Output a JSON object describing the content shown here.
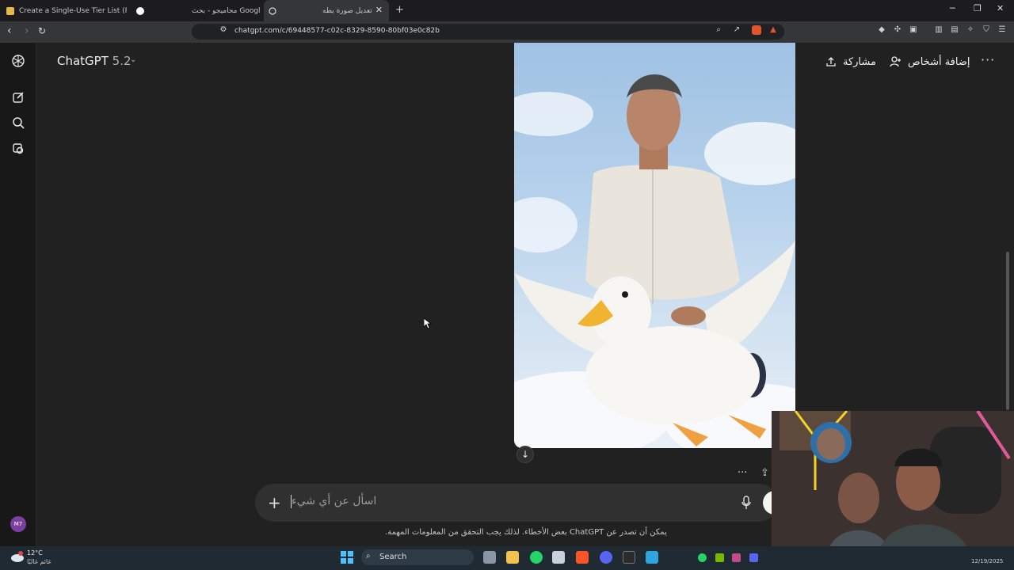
{
  "browser": {
    "tabs": [
      {
        "label": "Create a Single-Use Tier List (Private",
        "active": false
      },
      {
        "label": "محاميجو - بحث Google",
        "active": false
      },
      {
        "label": "تعديل صورة بطه",
        "active": true
      }
    ],
    "url": "chatgpt.com/c/69448577-c02c-8329-8590-80bf03e0c82b"
  },
  "header": {
    "model_name": "ChatGPT",
    "model_version": "5.2",
    "share_label": "مشاركة",
    "add_people_label": "إضافة أشخاص"
  },
  "rail": {
    "avatar_initials": "M7"
  },
  "composer": {
    "placeholder": "اسأل عن أي شيء"
  },
  "disclaimer": "يمكن أن تصدر عن ChatGPT بعض الأخطاء. لذلك يجب التحقق من المعلومات المهمة.",
  "taskbar": {
    "temperature": "12°C",
    "weather": "غائم غالبًا",
    "search_label": "Search",
    "date": "12/19/2025"
  },
  "colors": {
    "background": "#212121",
    "composer": "#303030",
    "taskbar": "#1f2a33"
  }
}
